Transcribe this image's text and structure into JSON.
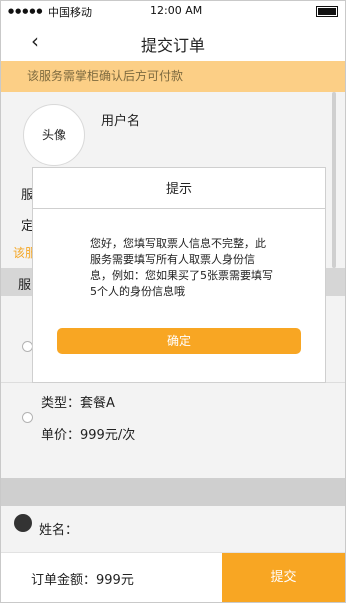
{
  "status_bar": {
    "signal": "●●●●●",
    "carrier": "中国移动",
    "time": "12:00 AM"
  },
  "nav": {
    "back_glyph": "‹",
    "title": "提交订单"
  },
  "notice": "该服务需掌柜确认后方可付款",
  "profile": {
    "avatar_text": "头像",
    "username": "用户名"
  },
  "background_fragments": {
    "row1": "服",
    "row2": "定",
    "row3": "该服",
    "row4": "服"
  },
  "package": {
    "type": "类型：套餐A",
    "price": "单价：999元/次"
  },
  "person": {
    "name_label": "姓名："
  },
  "bottom_bar": {
    "total": "订单金额：999元",
    "submit_label": "提交"
  },
  "dialog": {
    "title": "提示",
    "message": "您好，您填写取票人信息不完整，此服务需要填写所有人取票人身份信息，例如：您如果买了5张票需要填写5个人的身份信息哦",
    "confirm_label": "确定"
  },
  "colors": {
    "accent": "#f8a623",
    "notice_bg": "#fccf86"
  }
}
